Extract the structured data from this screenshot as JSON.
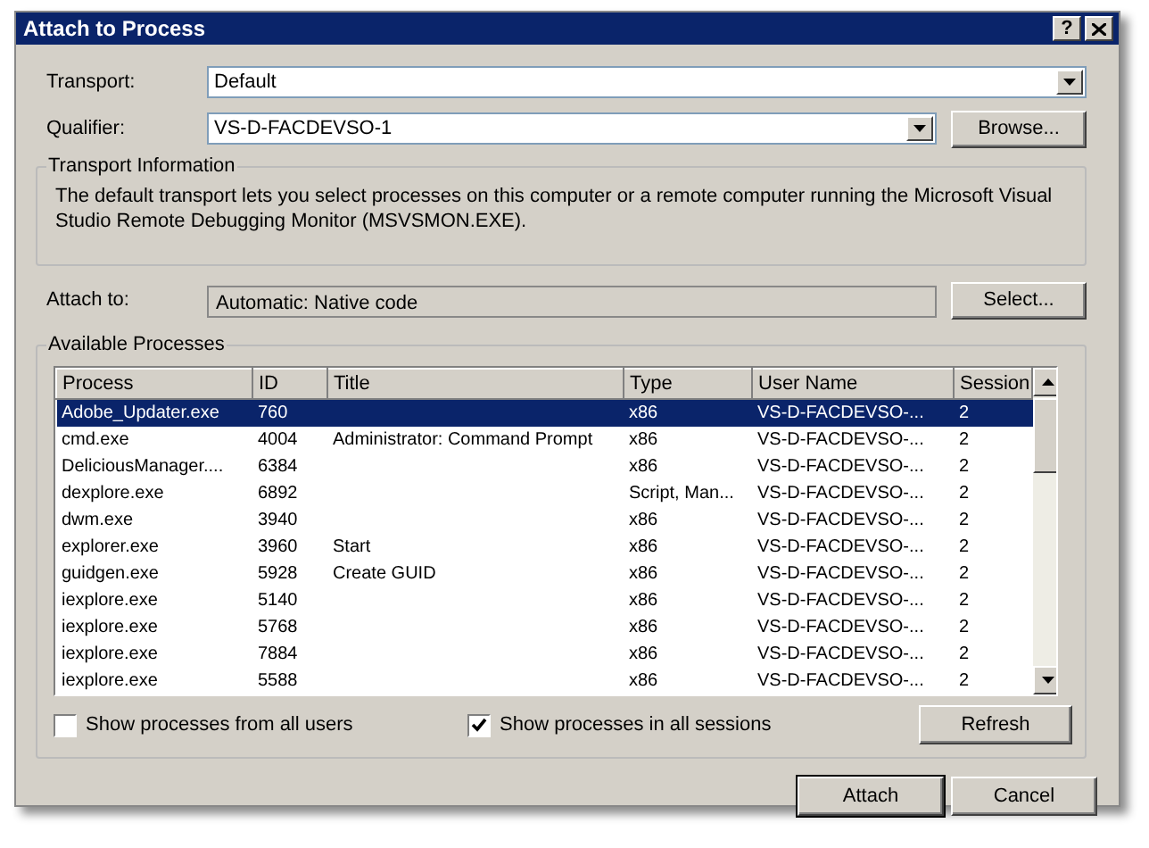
{
  "window": {
    "title": "Attach to Process",
    "help_button": "?"
  },
  "transport": {
    "label": "Transport:",
    "value": "Default"
  },
  "qualifier": {
    "label": "Qualifier:",
    "value": "VS-D-FACDEVSO-1",
    "button": "Browse..."
  },
  "transport_information": {
    "title": "Transport Information",
    "text": "The default transport lets you select processes on this computer or a remote computer running the Microsoft Visual Studio Remote Debugging Monitor (MSVSMON.EXE)."
  },
  "attach_to": {
    "label": "Attach to:",
    "value": "Automatic: Native code",
    "button": "Select..."
  },
  "available_processes": {
    "title": "Available Processes",
    "columns": [
      "Process",
      "ID",
      "Title",
      "Type",
      "User Name",
      "Session"
    ],
    "rows": [
      {
        "cells": [
          "Adobe_Updater.exe",
          "760",
          "",
          "x86",
          "VS-D-FACDEVSO-...",
          "2"
        ],
        "selected": true
      },
      {
        "cells": [
          "cmd.exe",
          "4004",
          "Administrator: Command Prompt",
          "x86",
          "VS-D-FACDEVSO-...",
          "2"
        ],
        "selected": false
      },
      {
        "cells": [
          "DeliciousManager....",
          "6384",
          "",
          "x86",
          "VS-D-FACDEVSO-...",
          "2"
        ],
        "selected": false
      },
      {
        "cells": [
          "dexplore.exe",
          "6892",
          "",
          "Script, Man...",
          "VS-D-FACDEVSO-...",
          "2"
        ],
        "selected": false
      },
      {
        "cells": [
          "dwm.exe",
          "3940",
          "",
          "x86",
          "VS-D-FACDEVSO-...",
          "2"
        ],
        "selected": false
      },
      {
        "cells": [
          "explorer.exe",
          "3960",
          "Start",
          "x86",
          "VS-D-FACDEVSO-...",
          "2"
        ],
        "selected": false
      },
      {
        "cells": [
          "guidgen.exe",
          "5928",
          "Create GUID",
          "x86",
          "VS-D-FACDEVSO-...",
          "2"
        ],
        "selected": false
      },
      {
        "cells": [
          "iexplore.exe",
          "5140",
          "",
          "x86",
          "VS-D-FACDEVSO-...",
          "2"
        ],
        "selected": false
      },
      {
        "cells": [
          "iexplore.exe",
          "5768",
          "",
          "x86",
          "VS-D-FACDEVSO-...",
          "2"
        ],
        "selected": false
      },
      {
        "cells": [
          "iexplore.exe",
          "7884",
          "",
          "x86",
          "VS-D-FACDEVSO-...",
          "2"
        ],
        "selected": false
      },
      {
        "cells": [
          "iexplore.exe",
          "5588",
          "",
          "x86",
          "VS-D-FACDEVSO-...",
          "2"
        ],
        "selected": false
      }
    ],
    "options": [
      {
        "label": "Show processes from all users",
        "checked": false
      },
      {
        "label": "Show processes in all sessions",
        "checked": true
      }
    ],
    "refresh_button": "Refresh"
  },
  "buttons": [
    "Attach",
    "Cancel"
  ]
}
